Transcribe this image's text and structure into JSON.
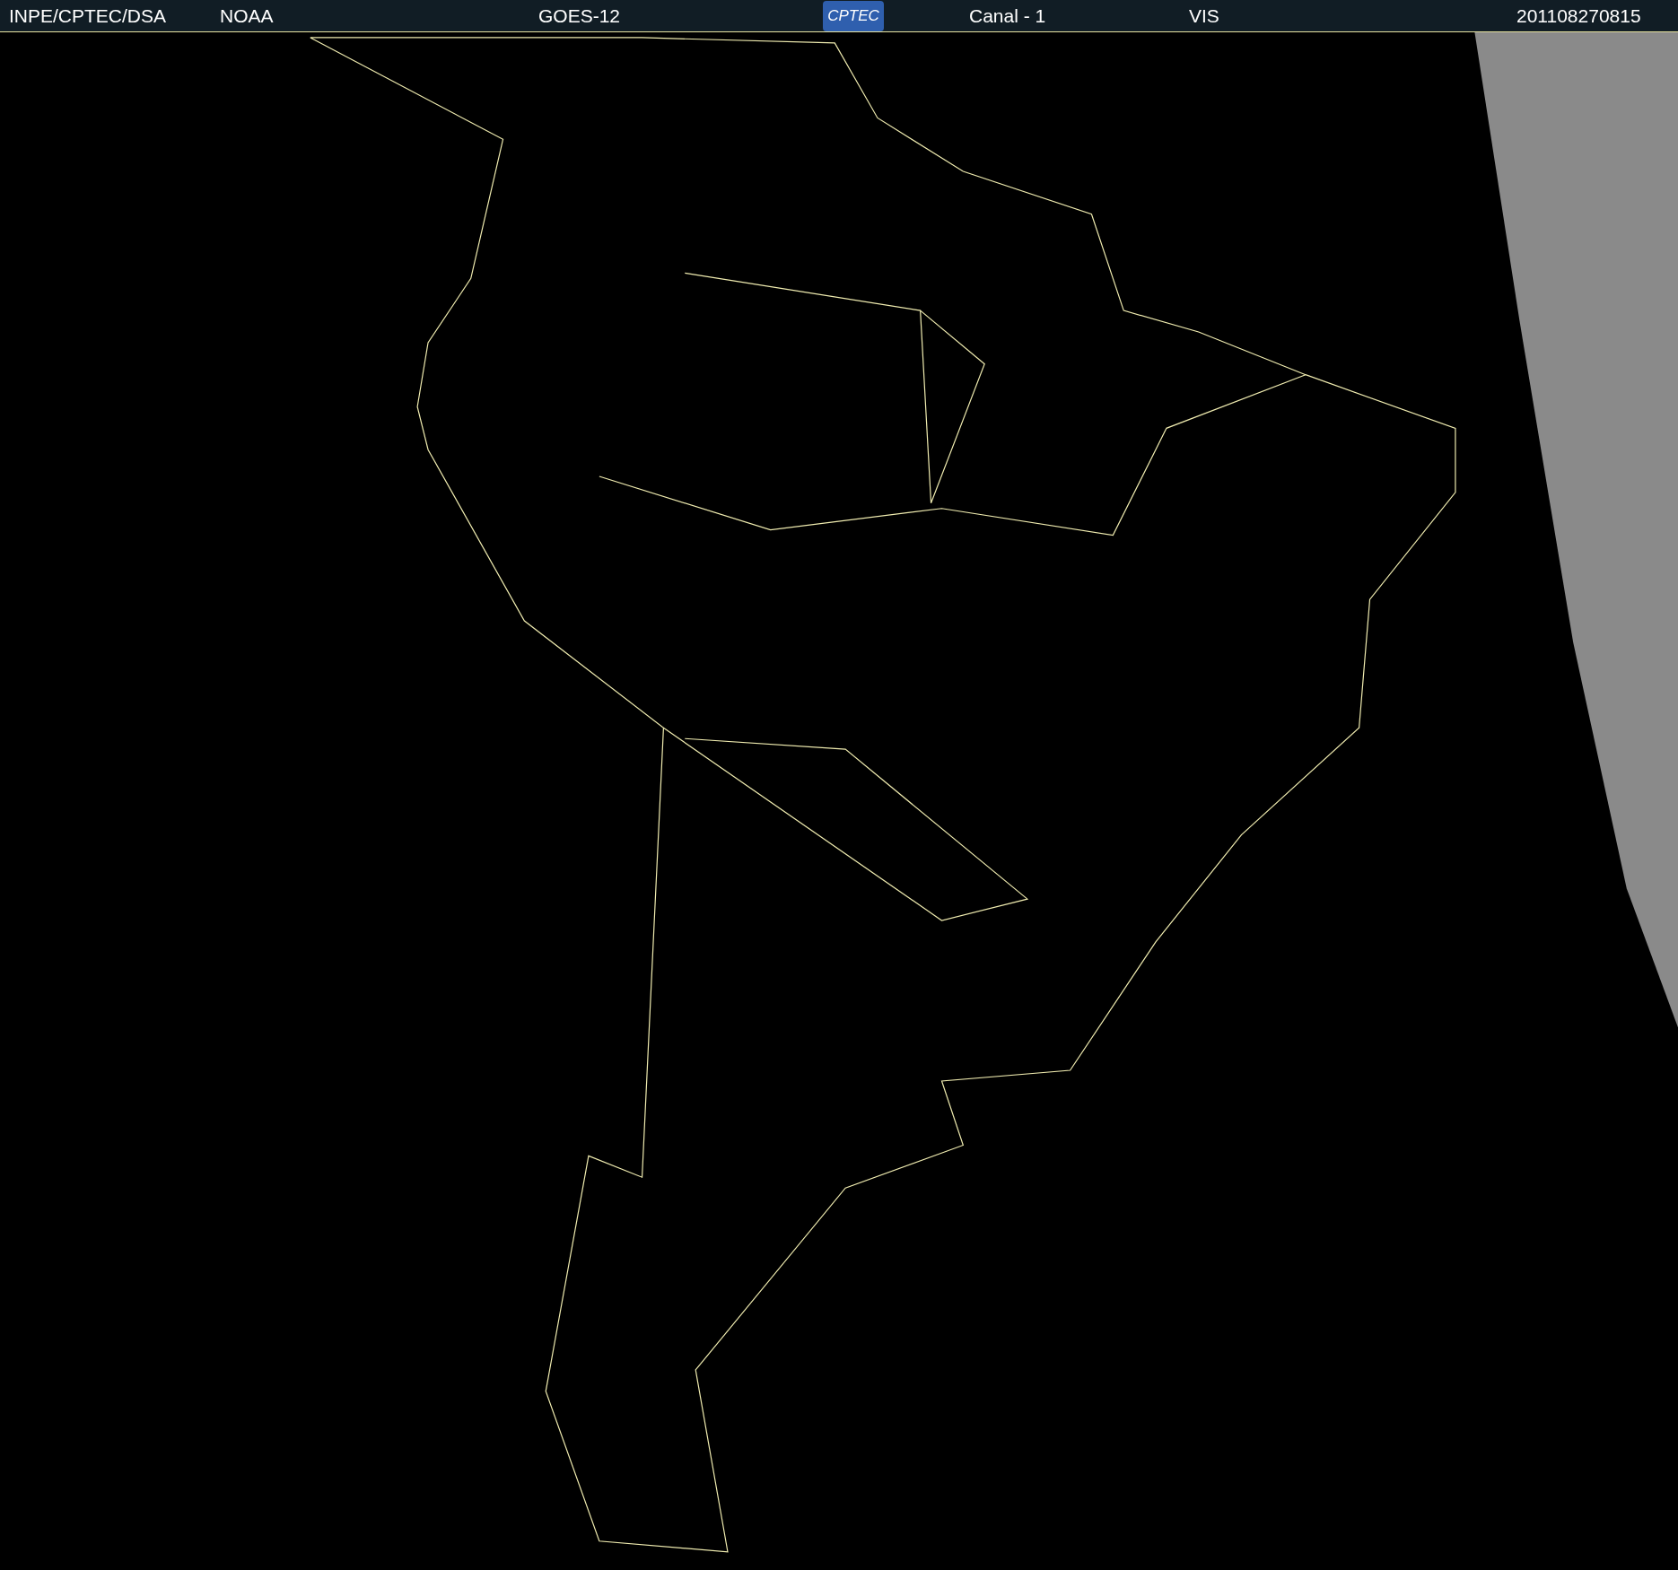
{
  "header": {
    "items": [
      {
        "kind": "text",
        "text": "INPE/CPTEC/DSA"
      },
      {
        "kind": "text",
        "text": "NOAA"
      },
      {
        "kind": "text",
        "text": "GOES-12"
      },
      {
        "kind": "logo",
        "text": "CPTEC"
      },
      {
        "kind": "text",
        "text": "Canal - 1"
      },
      {
        "kind": "text",
        "text": "VIS"
      },
      {
        "kind": "text",
        "text": "201108270815"
      }
    ]
  }
}
